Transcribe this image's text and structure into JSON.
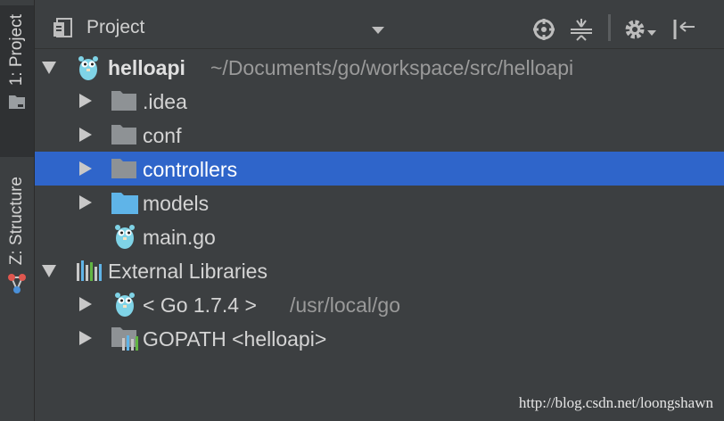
{
  "side_tabs": {
    "project": "1: Project",
    "structure": "Z: Structure"
  },
  "header": {
    "title": "Project"
  },
  "tree": {
    "root": {
      "name": "helloapi",
      "path": "~/Documents/go/workspace/src/helloapi"
    },
    "items": [
      {
        "label": ".idea"
      },
      {
        "label": "conf"
      },
      {
        "label": "controllers"
      },
      {
        "label": "models"
      },
      {
        "label": "main.go"
      }
    ],
    "external": {
      "label": "External Libraries",
      "go_sdk": "< Go 1.7.4 >",
      "go_sdk_path": "/usr/local/go",
      "gopath": "GOPATH <helloapi>"
    }
  },
  "watermark": "http://blog.csdn.net/loongshawn",
  "colors": {
    "background": "#3c3f41",
    "selection": "#2f65ca",
    "folder": "#8e9295",
    "models_folder": "#5fb4e8",
    "gopher": "#7fd3e6"
  },
  "icons": {
    "view": "project-view-icon",
    "dropdown": "chevron-down-icon",
    "locate": "crosshair-icon",
    "collapse": "collapse-all-icon",
    "settings": "gear-icon",
    "hide": "hide-panel-icon",
    "folder": "folder-icon",
    "gopher": "gopher-icon",
    "libraries": "libraries-icon"
  }
}
